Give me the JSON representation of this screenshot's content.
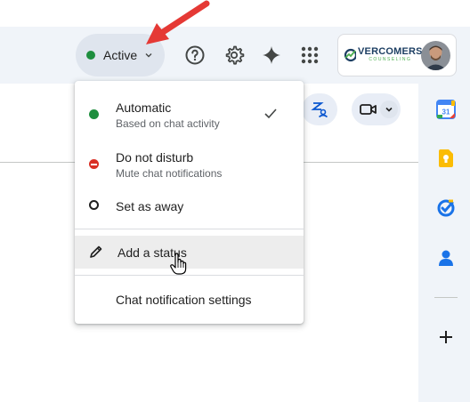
{
  "header": {
    "status_label": "Active",
    "status_color": "#1e8e3e",
    "icons": [
      "help-icon",
      "settings-gear-icon",
      "gemini-sparkle-icon",
      "apps-grid-icon"
    ],
    "account": {
      "logo_text": "VERCOMERS",
      "logo_sub": "COUNSELING"
    }
  },
  "status_menu": {
    "items": [
      {
        "title": "Automatic",
        "subtitle": "Based on chat activity",
        "icon": "green-dot-icon",
        "selected": true
      },
      {
        "title": "Do not disturb",
        "subtitle": "Mute chat notifications",
        "icon": "red-minus-icon",
        "selected": false
      },
      {
        "title": "Set as away",
        "icon": "away-circle-icon",
        "selected": false
      }
    ],
    "add_status": "Add a status",
    "notification_settings": "Chat notification settings"
  },
  "side_panel": {
    "apps": [
      "calendar-icon",
      "keep-icon",
      "tasks-icon",
      "contacts-icon"
    ],
    "calendar_day": "31"
  },
  "colors": {
    "accent_blue": "#0b57d0",
    "active_green": "#1e8e3e",
    "dnd_red": "#d93025"
  }
}
